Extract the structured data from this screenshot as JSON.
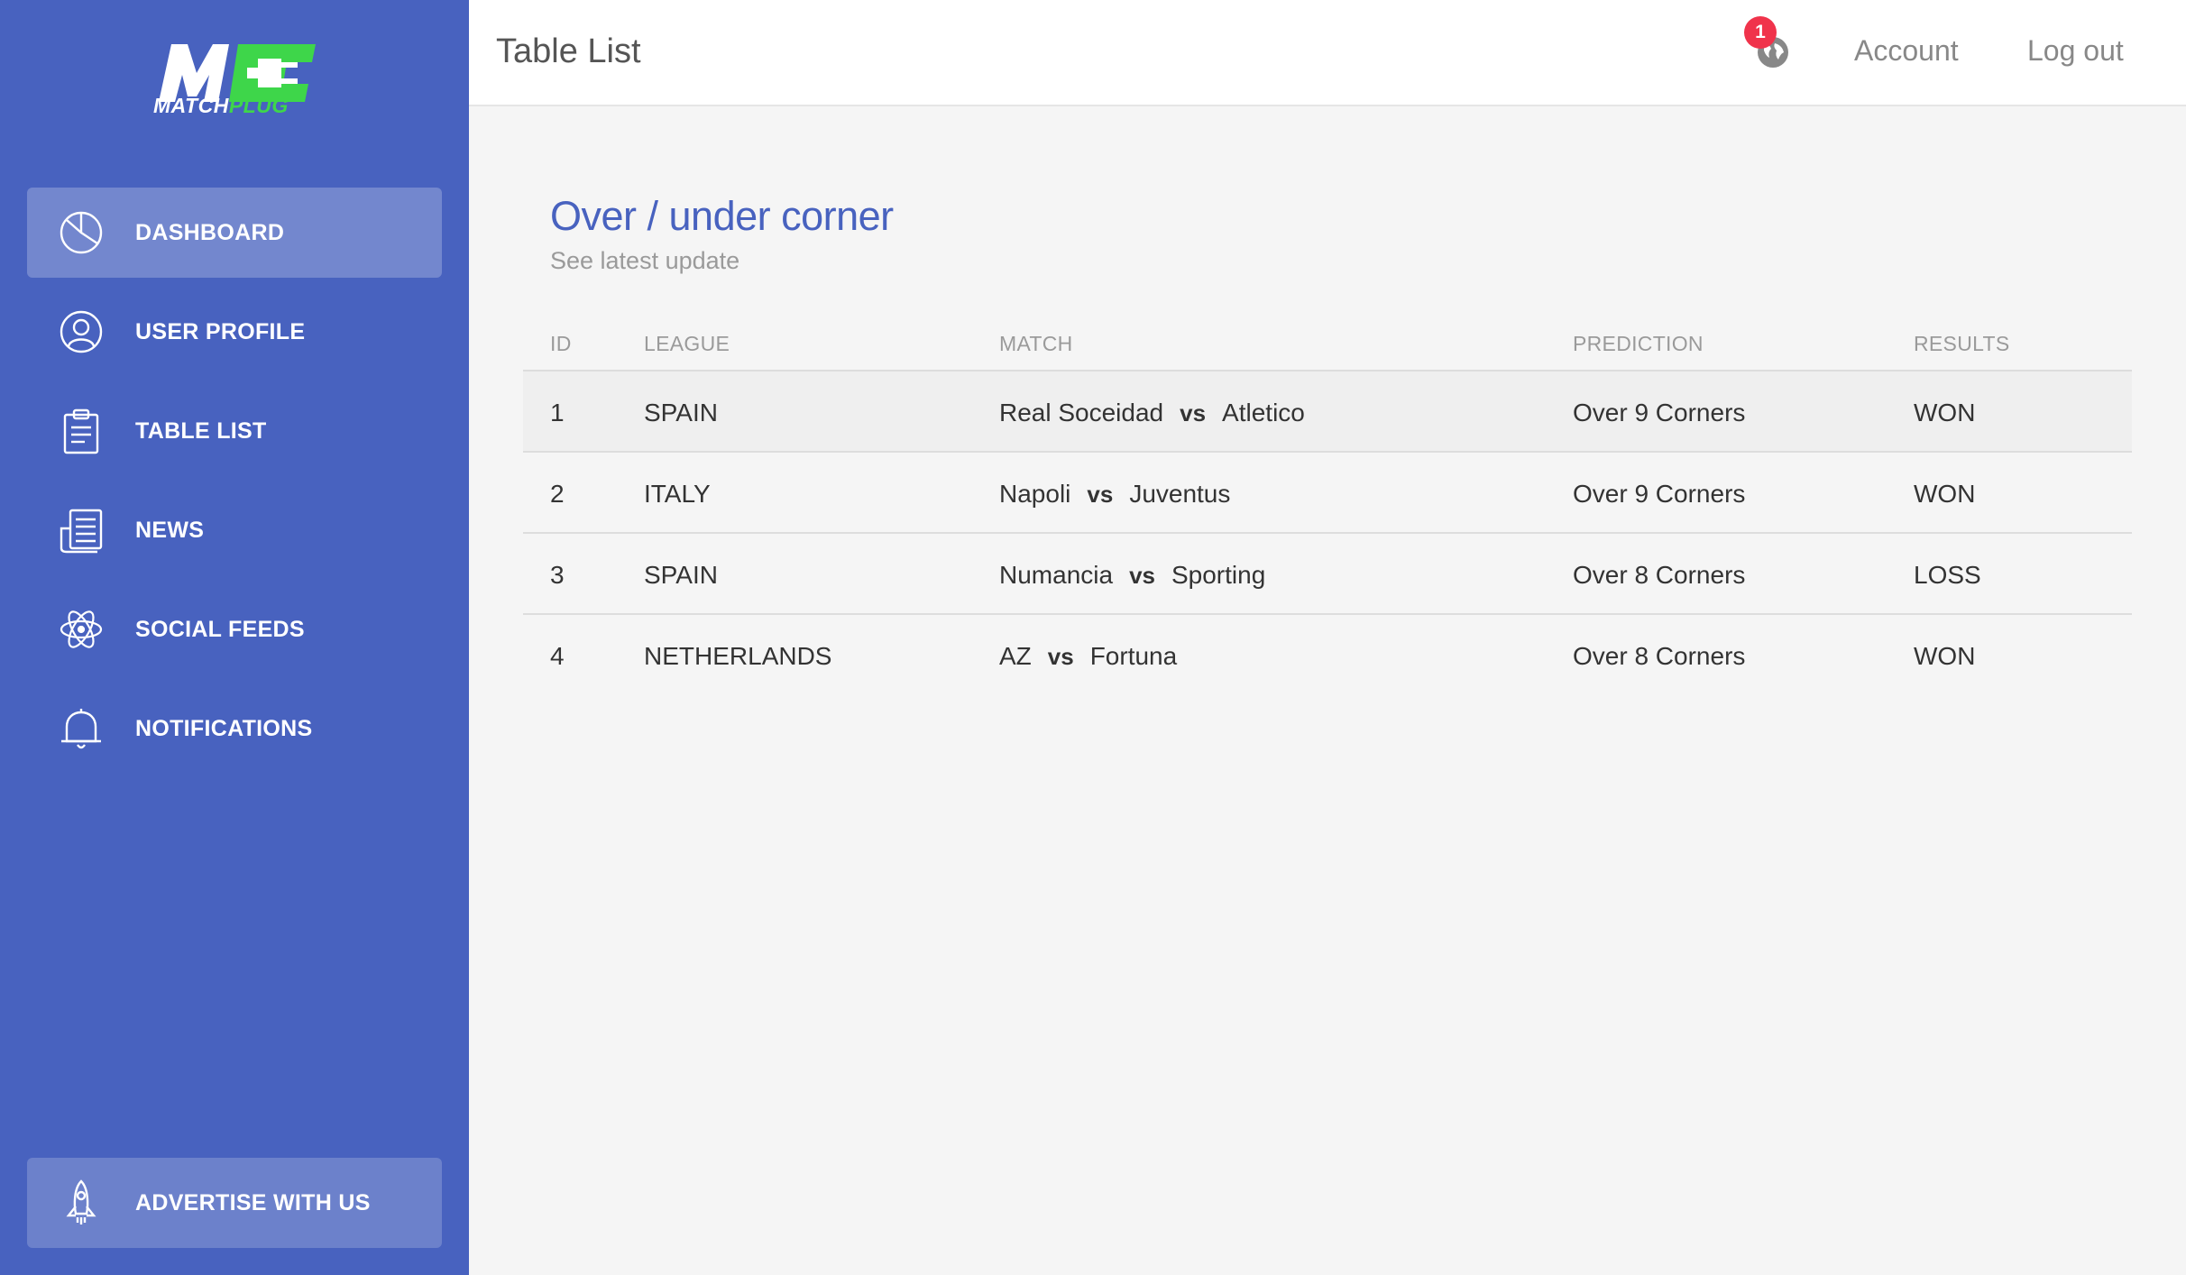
{
  "brand": {
    "logo_mark": "MC",
    "name_white": "MATCH",
    "name_green": "PLUG",
    "colors": {
      "sidebar": "#4862bf",
      "accent": "#3ed64a",
      "badge": "#f0334b",
      "title": "#4862bf"
    }
  },
  "sidebar": {
    "items": [
      {
        "label": "DASHBOARD",
        "icon": "pie-chart-icon",
        "active": true
      },
      {
        "label": "USER PROFILE",
        "icon": "user-icon",
        "active": false
      },
      {
        "label": "TABLE LIST",
        "icon": "clipboard-icon",
        "active": false
      },
      {
        "label": "NEWS",
        "icon": "newspaper-icon",
        "active": false
      },
      {
        "label": "SOCIAL FEEDS",
        "icon": "atom-icon",
        "active": false
      },
      {
        "label": "NOTIFICATIONS",
        "icon": "bell-icon",
        "active": false
      }
    ],
    "footer": {
      "label": "ADVERTISE WITH US",
      "icon": "rocket-icon"
    }
  },
  "header": {
    "title": "Table List",
    "notification_count": "1",
    "notification_icon": "globe-icon",
    "links": {
      "account": "Account",
      "logout": "Log out"
    }
  },
  "card": {
    "title": "Over / under corner",
    "subtitle": "See latest update"
  },
  "table": {
    "columns": [
      "ID",
      "LEAGUE",
      "MATCH",
      "PREDICTION",
      "RESULTS"
    ],
    "rows": [
      {
        "id": "1",
        "league": "SPAIN",
        "home": "Real Soceidad",
        "vs": "vs",
        "away": "Atletico",
        "prediction": "Over 9 Corners",
        "result": "WON"
      },
      {
        "id": "2",
        "league": "ITALY",
        "home": "Napoli",
        "vs": "vs",
        "away": "Juventus",
        "prediction": "Over 9 Corners",
        "result": "WON"
      },
      {
        "id": "3",
        "league": "SPAIN",
        "home": "Numancia",
        "vs": "vs",
        "away": "Sporting",
        "prediction": "Over 8 Corners",
        "result": "LOSS"
      },
      {
        "id": "4",
        "league": "NETHERLANDS",
        "home": "AZ",
        "vs": "vs",
        "away": "Fortuna",
        "prediction": "Over 8 Corners",
        "result": "WON"
      }
    ]
  }
}
